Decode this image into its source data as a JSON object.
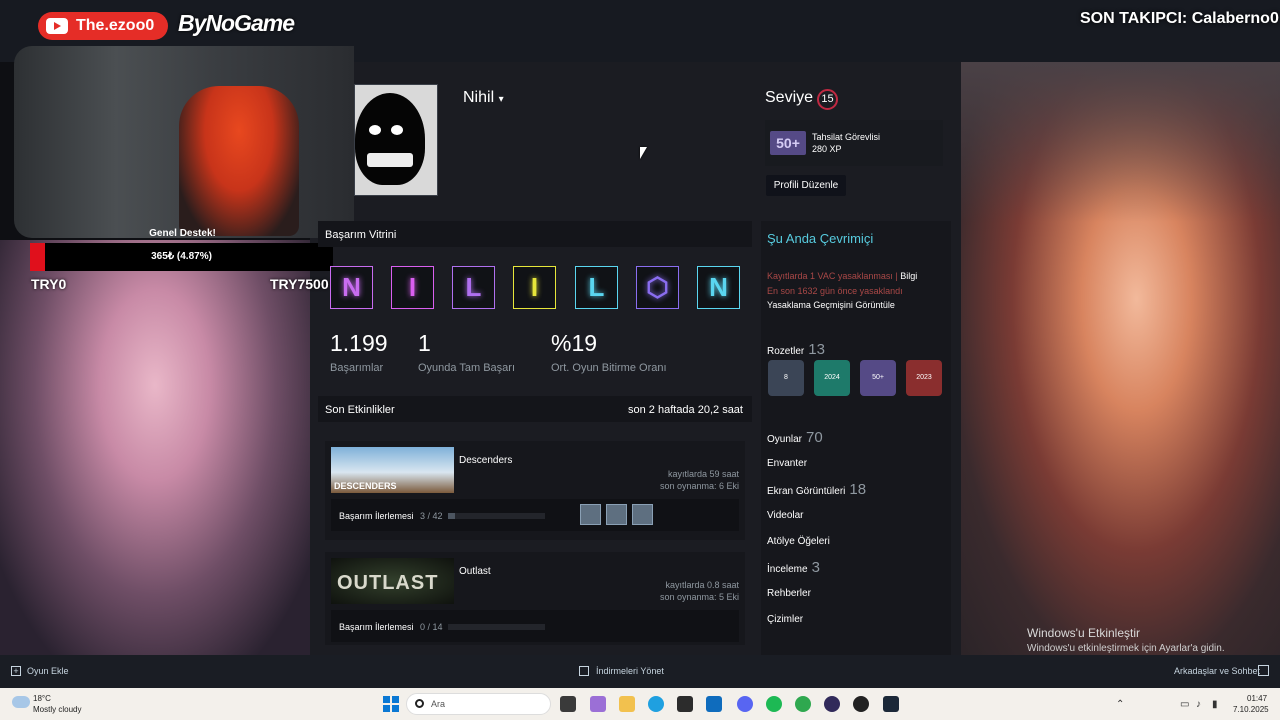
{
  "overlay": {
    "youtube_channel": "The.ezoo0",
    "brand": "ByNoGame",
    "last_follower": "SON TAKIPCI: Calaberno0",
    "donation": {
      "title": "Genel Destek!",
      "amount_text": "365₺ (4.87%)",
      "progress_fraction": 0.0487,
      "min_label": "TRY0",
      "max_label": "TRY7500"
    }
  },
  "profile": {
    "persona_name": "Nihil",
    "level_label": "Seviye",
    "level": "15",
    "featured_badge": {
      "name": "Tahsilat Görevlisi",
      "xp": "280 XP",
      "icon_text": "50+"
    },
    "edit_button": "Profili Düzenle"
  },
  "showcase": {
    "title": "Başarım Vitrini",
    "tiles": [
      {
        "letter": "N",
        "color": "#c86cf0"
      },
      {
        "letter": "I",
        "color": "#d95ff0"
      },
      {
        "letter": "L",
        "color": "#b070f0"
      },
      {
        "letter": "I",
        "color": "#e6e63a"
      },
      {
        "letter": "L",
        "color": "#5ad6f0"
      },
      {
        "letter": "⬡",
        "color": "#8a6df0"
      },
      {
        "letter": "N",
        "color": "#5ad6f0"
      }
    ],
    "stats": [
      {
        "value": "1.199",
        "label": "Başarımlar"
      },
      {
        "value": "1",
        "label": "Oyunda Tam Başarı"
      },
      {
        "value": "%19",
        "label": "Ort. Oyun Bitirme Oranı"
      }
    ]
  },
  "recent": {
    "title": "Son Etkinlikler",
    "hours": "son 2 haftada 20,2 saat",
    "games": [
      {
        "name": "Descenders",
        "record": "kayıtlarda 59 saat",
        "last_played": "son oynanma: 6 Eki",
        "progress_label": "Başarım İlerlemesi",
        "progress": "3 / 42",
        "thumb_text": "DESCENDERS"
      },
      {
        "name": "Outlast",
        "record": "kayıtlarda 0.8 saat",
        "last_played": "son oynanma: 5 Eki",
        "progress_label": "Başarım İlerlemesi",
        "progress": "0 / 14",
        "thumb_text": "OUTLAST"
      }
    ]
  },
  "sidebar": {
    "status": "Şu Anda Çevrimiçi",
    "vac": "Kayıtlarda 1 VAC yasaklanması",
    "vac_info": "Bilgi",
    "vac_days": "En son 1632 gün önce yasaklandı",
    "vac_history": "Yasaklama Geçmişini Görüntüle",
    "badges_label": "Rozetler",
    "badges_count": "13",
    "badges": [
      {
        "text": "8",
        "color": "#3b4556"
      },
      {
        "text": "2024",
        "color": "#1e7a6a"
      },
      {
        "text": "50+",
        "color": "#554a86"
      },
      {
        "text": "2023",
        "color": "#8a2e2e"
      }
    ],
    "games_label": "Oyunlar",
    "games_count": "70",
    "inventory": "Envanter",
    "screenshots_label": "Ekran Görüntüleri",
    "screenshots_count": "18",
    "videos": "Videolar",
    "workshop": "Atölye Öğeleri",
    "reviews_label": "İnceleme",
    "reviews_count": "3",
    "guides": "Rehberler",
    "artwork": "Çizimler"
  },
  "watermark": {
    "line1": "Windows'u Etkinleştir",
    "line2": "Windows'u etkinleştirmek için Ayarlar'a gidin."
  },
  "steam_bottom": {
    "add_game": "Oyun Ekle",
    "downloads": "İndirmeleri Yönet",
    "friends": "Arkadaşlar ve Sohbet"
  },
  "taskbar": {
    "temp": "18°C",
    "weather": "Mostly cloudy",
    "search_placeholder": "Ara",
    "time": "01:47",
    "date": "7.10.2025"
  }
}
